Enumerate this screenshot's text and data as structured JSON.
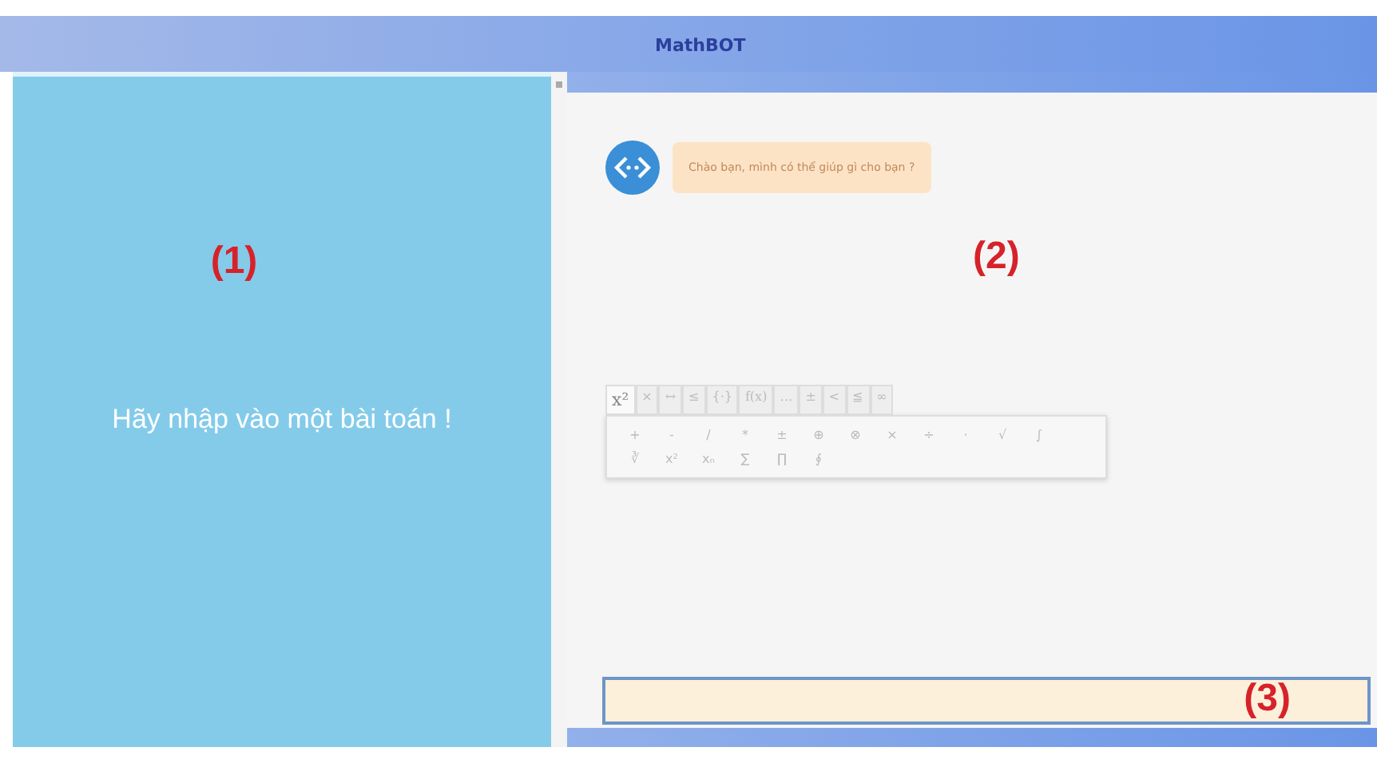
{
  "header": {
    "title": "MathBOT"
  },
  "left_panel": {
    "marker": "(1)",
    "prompt": "Hãy nhập vào một bài toán !"
  },
  "chat": {
    "marker": "(2)",
    "messages": [
      {
        "kind": "bot",
        "text": "Chào bạn, mình có thể giúp gì cho bạn ?"
      }
    ]
  },
  "keyboard": {
    "tabs": [
      {
        "label": "x²",
        "selected": true
      },
      {
        "label": "×",
        "selected": false
      },
      {
        "label": "↔",
        "selected": false
      },
      {
        "label": "≤",
        "selected": false
      },
      {
        "label": "{·}",
        "selected": false
      },
      {
        "label": "f(x)",
        "selected": false
      },
      {
        "label": "…",
        "selected": false
      },
      {
        "label": "±",
        "selected": false
      },
      {
        "label": "<",
        "selected": false
      },
      {
        "label": "≦",
        "selected": false
      },
      {
        "label": "∞",
        "selected": false
      }
    ],
    "rows": [
      [
        "+",
        "-",
        "/",
        "*",
        "±",
        "⊕",
        "⊗",
        "×",
        "÷",
        "·",
        "√",
        "∫"
      ],
      [
        "∛",
        "x²",
        "xₙ",
        "∑",
        "∏",
        "∮"
      ]
    ]
  },
  "input": {
    "marker": "(3)"
  }
}
